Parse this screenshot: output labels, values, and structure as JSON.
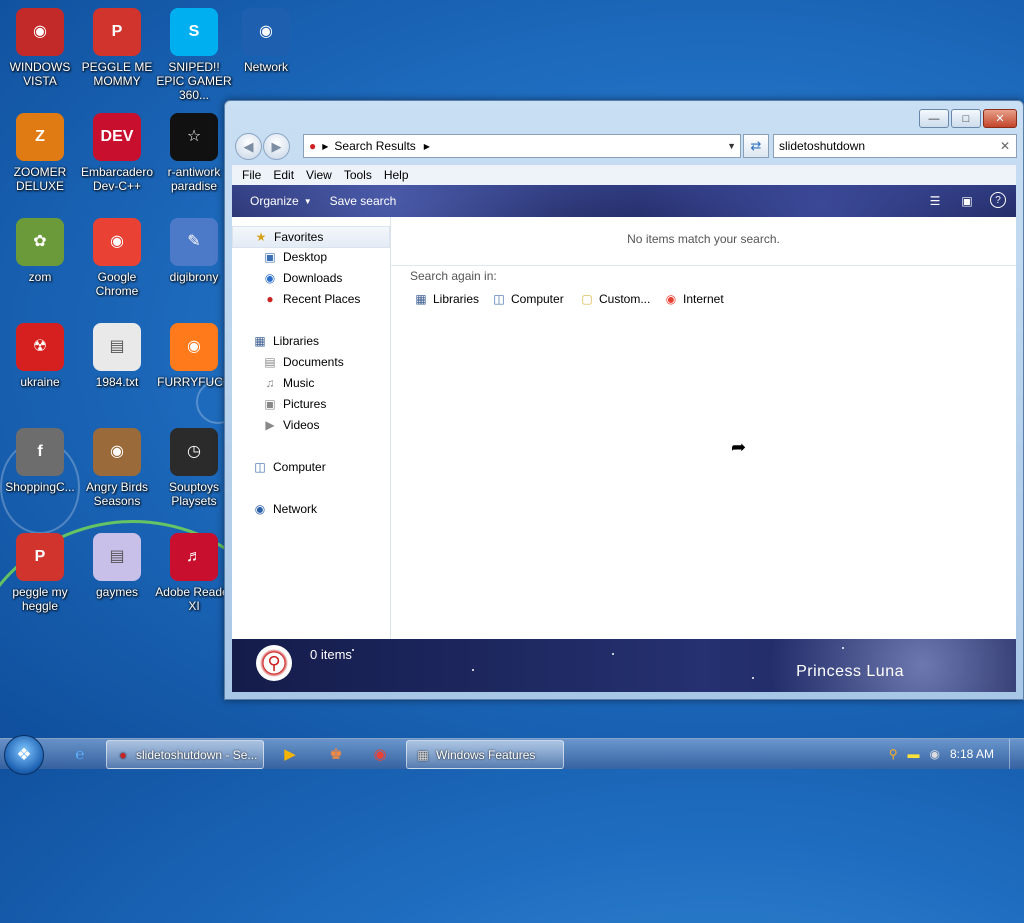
{
  "desktop": {
    "icons": [
      {
        "label": "WINDOWS VISTA",
        "icon": "vista-icon",
        "color": "#c22a2a"
      },
      {
        "label": "PEGGLE ME MOMMY",
        "icon": "peggle-icon",
        "color": "#d0342c"
      },
      {
        "label": "SNIPED!! EPIC GAMER 360...",
        "icon": "skype-icon",
        "color": "#00aff0"
      },
      {
        "label": "Network",
        "icon": "network-icon",
        "color": "#1f5fb0"
      },
      {
        "label": "ZOOMER DELUXE",
        "icon": "zoomer-icon",
        "color": "#e07a12"
      },
      {
        "label": "Embarcadero Dev-C++",
        "icon": "devcpp-icon",
        "color": "#c8102e"
      },
      {
        "label": "r-antiwork paradise",
        "icon": "antiwork-icon",
        "color": "#111111"
      },
      {
        "label": "zom",
        "icon": "flower-icon",
        "color": "#6a9a3a"
      },
      {
        "label": "Google Chrome",
        "icon": "chrome-icon",
        "color": "#e94235"
      },
      {
        "label": "digibrony",
        "icon": "brush-icon",
        "color": "#4d79c9"
      },
      {
        "label": "ukraine",
        "icon": "radiation-icon",
        "color": "#d62020"
      },
      {
        "label": "1984.txt",
        "icon": "text-file-icon",
        "color": "#e9e9e9"
      },
      {
        "label": "FURRYFUCK",
        "icon": "firefox-icon",
        "color": "#ff7a1a"
      },
      {
        "label": "ShoppingC...",
        "icon": "flash-icon",
        "color": "#6d6d6d"
      },
      {
        "label": "Angry Birds Seasons",
        "icon": "angry-birds-icon",
        "color": "#9b6a3a"
      },
      {
        "label": "Souptoys Playsets",
        "icon": "souptoys-icon",
        "color": "#2b2b2b"
      },
      {
        "label": "peggle my heggle",
        "icon": "peggle-icon",
        "color": "#d0342c"
      },
      {
        "label": "gaymes",
        "icon": "folder-icon",
        "color": "#c8c0e8"
      },
      {
        "label": "Adobe Reader XI",
        "icon": "adobe-reader-icon",
        "color": "#c8102e"
      }
    ]
  },
  "window": {
    "address": "Search Results",
    "search_value": "slidetoshutdown",
    "menu": [
      "File",
      "Edit",
      "View",
      "Tools",
      "Help"
    ],
    "toolbar": {
      "organize": "Organize",
      "save_search": "Save search"
    },
    "nav": {
      "favorites": "Favorites",
      "desktop": "Desktop",
      "downloads": "Downloads",
      "recent_places": "Recent Places",
      "libraries": "Libraries",
      "documents": "Documents",
      "music": "Music",
      "pictures": "Pictures",
      "videos": "Videos",
      "computer": "Computer",
      "network": "Network"
    },
    "main": {
      "no_items": "No items match your search.",
      "search_again": "Search again in:",
      "locations": [
        "Libraries",
        "Computer",
        "Custom...",
        "Internet"
      ]
    },
    "details": {
      "count": "0 items",
      "brand": "Princess Luna"
    }
  },
  "taskbar": {
    "tasks": {
      "explorer": "slidetoshutdown - Se...",
      "features": "Windows Features"
    },
    "clock": "8:18 AM"
  },
  "colors": {
    "accent": "#1f6dc0",
    "toolbar": "#1d255a"
  }
}
